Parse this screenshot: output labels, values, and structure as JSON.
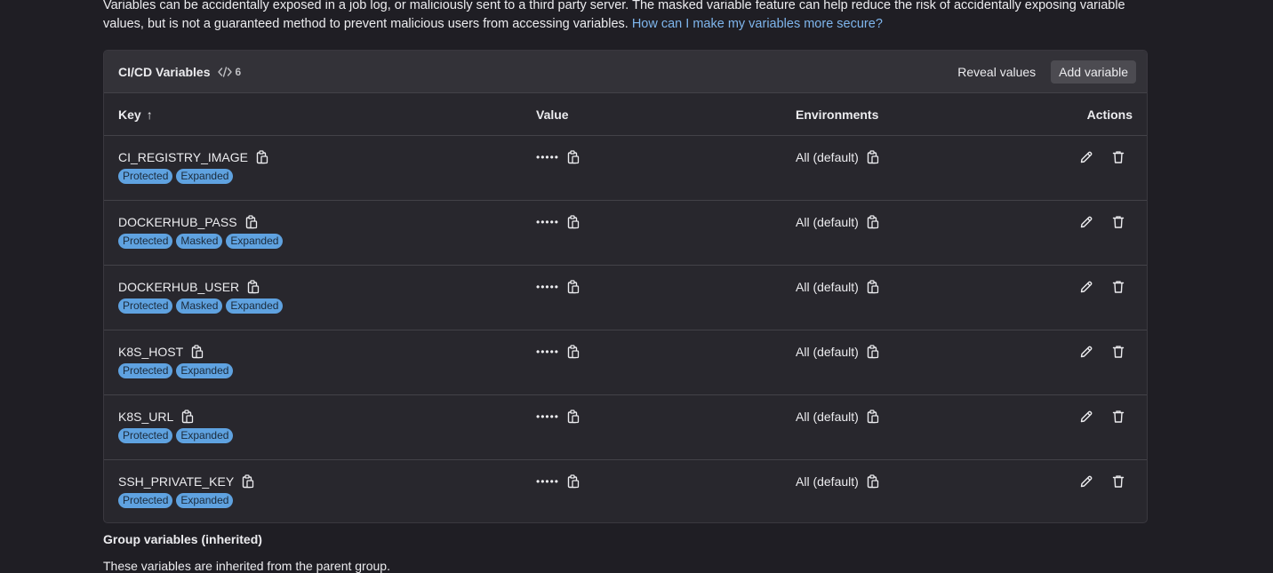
{
  "intro": {
    "text": "Variables can be accidentally exposed in a job log, or maliciously sent to a third party server. The masked variable feature can help reduce the risk of accidentally exposing variable values, but is not a guaranteed method to prevent malicious users from accessing variables.",
    "link": "How can I make my variables more secure?"
  },
  "card": {
    "title": "CI/CD Variables",
    "count": "6",
    "reveal_label": "Reveal values",
    "add_label": "Add variable"
  },
  "table": {
    "headers": {
      "key": "Key",
      "sort_icon": "↑",
      "value": "Value",
      "environments": "Environments",
      "actions": "Actions"
    },
    "rows": [
      {
        "key": "CI_REGISTRY_IMAGE",
        "value": "•••••",
        "env": "All (default)",
        "badges": [
          "Protected",
          "Expanded"
        ]
      },
      {
        "key": "DOCKERHUB_PASS",
        "value": "•••••",
        "env": "All (default)",
        "badges": [
          "Protected",
          "Masked",
          "Expanded"
        ]
      },
      {
        "key": "DOCKERHUB_USER",
        "value": "•••••",
        "env": "All (default)",
        "badges": [
          "Protected",
          "Masked",
          "Expanded"
        ]
      },
      {
        "key": "K8S_HOST",
        "value": "•••••",
        "env": "All (default)",
        "badges": [
          "Protected",
          "Expanded"
        ]
      },
      {
        "key": "K8S_URL",
        "value": "•••••",
        "env": "All (default)",
        "badges": [
          "Protected",
          "Expanded"
        ]
      },
      {
        "key": "SSH_PRIVATE_KEY",
        "value": "•••••",
        "env": "All (default)",
        "badges": [
          "Protected",
          "Expanded"
        ]
      }
    ]
  },
  "group_section": {
    "title": "Group variables (inherited)",
    "description": "These variables are inherited from the parent group."
  },
  "colors": {
    "background": "#1f1e24",
    "card": "#28272d",
    "badge": "#5fa2e0",
    "link": "#7fb6ed"
  }
}
